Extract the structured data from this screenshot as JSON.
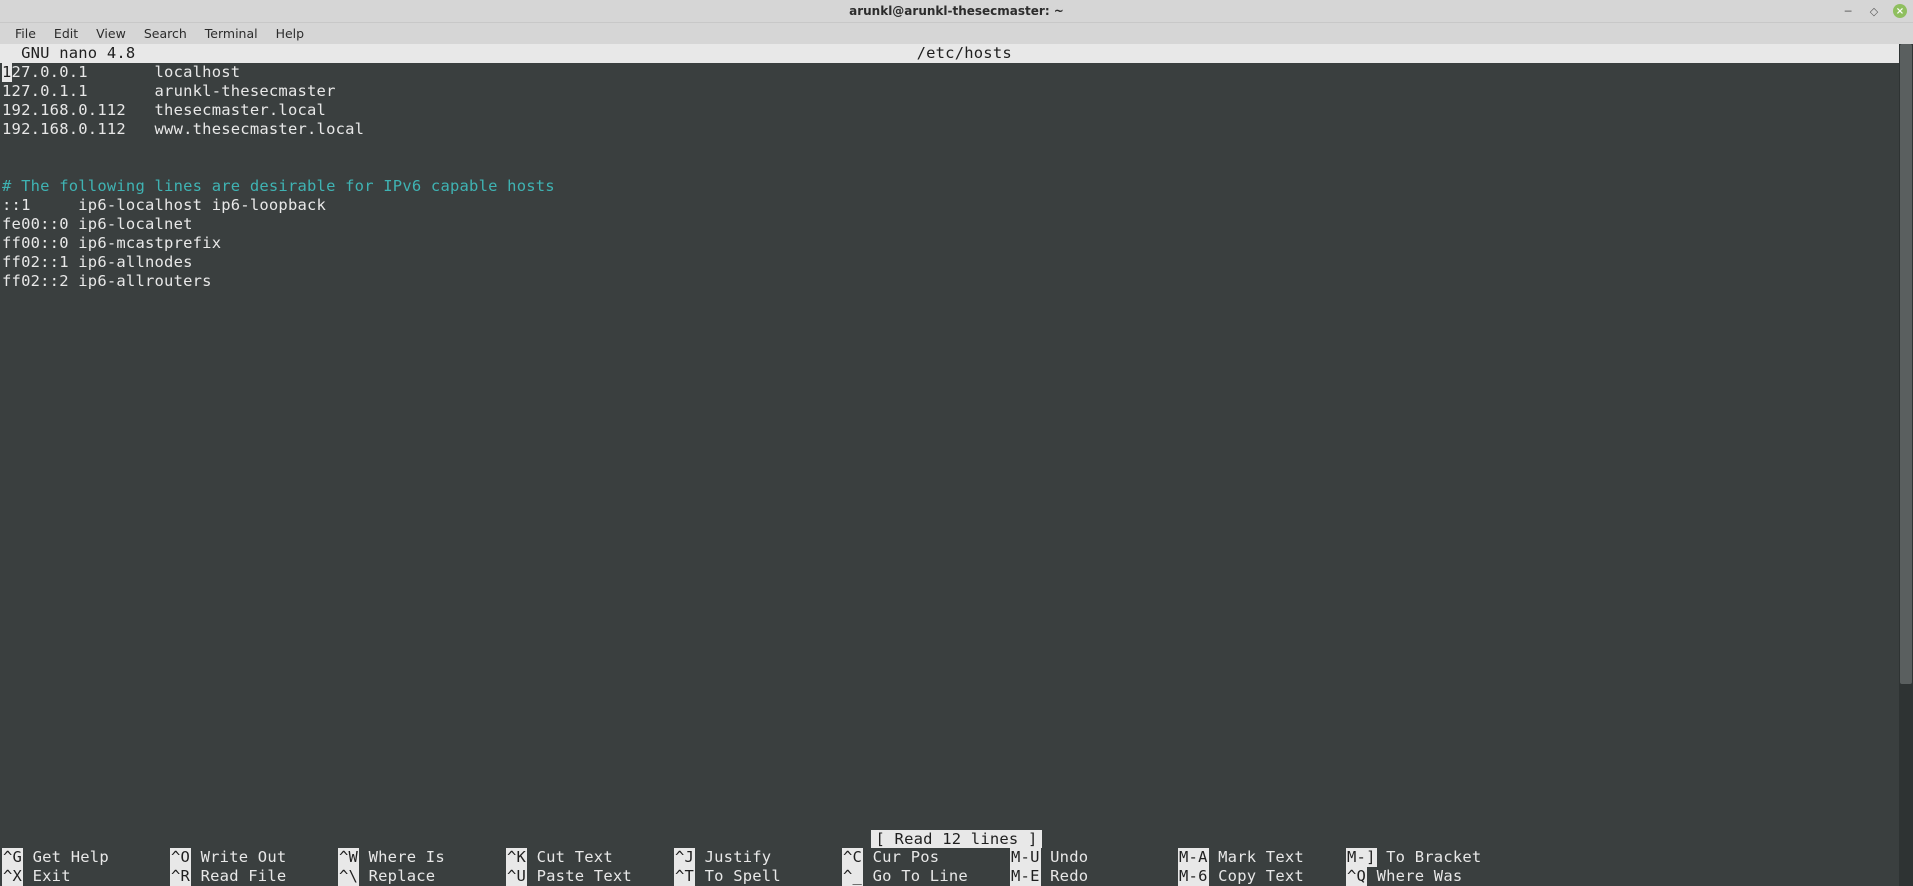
{
  "titlebar": {
    "title": "arunkl@arunkl-thesecmaster: ~"
  },
  "menubar": {
    "items": [
      "File",
      "Edit",
      "View",
      "Search",
      "Terminal",
      "Help"
    ]
  },
  "nano": {
    "app_label": "  GNU nano 4.8",
    "filename": "/etc/hosts",
    "status": "[ Read 12 lines ]"
  },
  "file_content": {
    "lines": [
      {
        "type": "cursor_line",
        "first_char": "1",
        "rest": "27.0.0.1       localhost"
      },
      {
        "type": "text",
        "text": "127.0.1.1       arunkl-thesecmaster"
      },
      {
        "type": "text",
        "text": "192.168.0.112   thesecmaster.local"
      },
      {
        "type": "text",
        "text": "192.168.0.112   www.thesecmaster.local"
      },
      {
        "type": "blank",
        "text": ""
      },
      {
        "type": "blank",
        "text": ""
      },
      {
        "type": "comment",
        "text": "# The following lines are desirable for IPv6 capable hosts"
      },
      {
        "type": "text",
        "text": "::1     ip6-localhost ip6-loopback"
      },
      {
        "type": "text",
        "text": "fe00::0 ip6-localnet"
      },
      {
        "type": "text",
        "text": "ff00::0 ip6-mcastprefix"
      },
      {
        "type": "text",
        "text": "ff02::1 ip6-allnodes"
      },
      {
        "type": "text",
        "text": "ff02::2 ip6-allrouters"
      }
    ]
  },
  "shortcuts": {
    "row1": [
      {
        "key": "^G",
        "label": "Get Help"
      },
      {
        "key": "^O",
        "label": "Write Out"
      },
      {
        "key": "^W",
        "label": "Where Is"
      },
      {
        "key": "^K",
        "label": "Cut Text"
      },
      {
        "key": "^J",
        "label": "Justify"
      },
      {
        "key": "^C",
        "label": "Cur Pos"
      },
      {
        "key": "M-U",
        "label": "Undo"
      },
      {
        "key": "M-A",
        "label": "Mark Text"
      },
      {
        "key": "M-]",
        "label": "To Bracket"
      }
    ],
    "row2": [
      {
        "key": "^X",
        "label": "Exit"
      },
      {
        "key": "^R",
        "label": "Read File"
      },
      {
        "key": "^\\",
        "label": "Replace"
      },
      {
        "key": "^U",
        "label": "Paste Text"
      },
      {
        "key": "^T",
        "label": "To Spell"
      },
      {
        "key": "^_",
        "label": "Go To Line"
      },
      {
        "key": "M-E",
        "label": "Redo"
      },
      {
        "key": "M-6",
        "label": "Copy Text"
      },
      {
        "key": "^Q",
        "label": "Where Was"
      }
    ]
  }
}
